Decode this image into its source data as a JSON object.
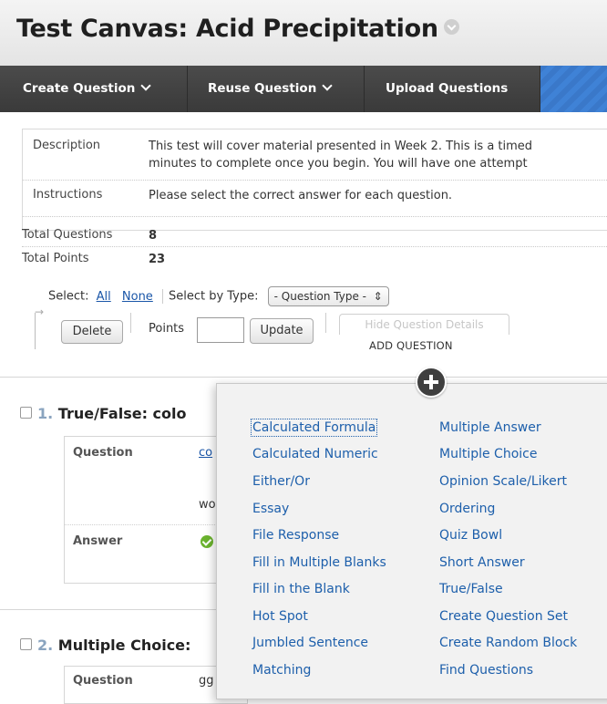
{
  "page": {
    "title": "Test Canvas: Acid Precipitation"
  },
  "action_bar": {
    "create_question": "Create Question",
    "reuse_question": "Reuse Question",
    "upload_questions": "Upload Questions"
  },
  "details": {
    "description_label": "Description",
    "description_line1": "This test will cover material presented in Week 2. This is a timed",
    "description_line2": "minutes to complete once you begin.  You will have one attempt",
    "instructions_label": "Instructions",
    "instructions_value": "Please select the correct answer for each question.",
    "total_questions_label": "Total Questions",
    "total_questions_value": "8",
    "total_points_label": "Total Points",
    "total_points_value": "23"
  },
  "controls": {
    "select_label": "Select:",
    "all_link": "All",
    "none_link": "None",
    "select_by_type_label": "Select by Type:",
    "question_type_select": "- Question Type -",
    "delete_button": "Delete",
    "points_label": "Points",
    "points_value": "",
    "update_button": "Update",
    "hide_details_button": "Hide Question Details",
    "add_question_label": "ADD QUESTION"
  },
  "questions": [
    {
      "number": "1.",
      "title": "True/False: colo",
      "question_label": "Question",
      "question_snippet": "co",
      "question_snippet2": "wo",
      "answer_label": "Answer"
    },
    {
      "number": "2.",
      "title": "Multiple Choice:",
      "question_label": "Question",
      "question_snippet": "gg"
    }
  ],
  "add_question_menu": {
    "left": [
      "Calculated Formula",
      "Calculated Numeric",
      "Either/Or",
      "Essay",
      "File Response",
      "Fill in Multiple Blanks",
      "Fill in the Blank",
      "Hot Spot",
      "Jumbled Sentence",
      "Matching"
    ],
    "right": [
      "Multiple Answer",
      "Multiple Choice",
      "Opinion Scale/Likert",
      "Ordering",
      "Quiz Bowl",
      "Short Answer",
      "True/False",
      "Create Question Set",
      "Create Random Block",
      "Find Questions"
    ]
  },
  "colors": {
    "action_bar": "#424242",
    "link": "#1d5fab",
    "accent_stripes": "#3f82d6",
    "correct_check": "#6bb32e"
  }
}
